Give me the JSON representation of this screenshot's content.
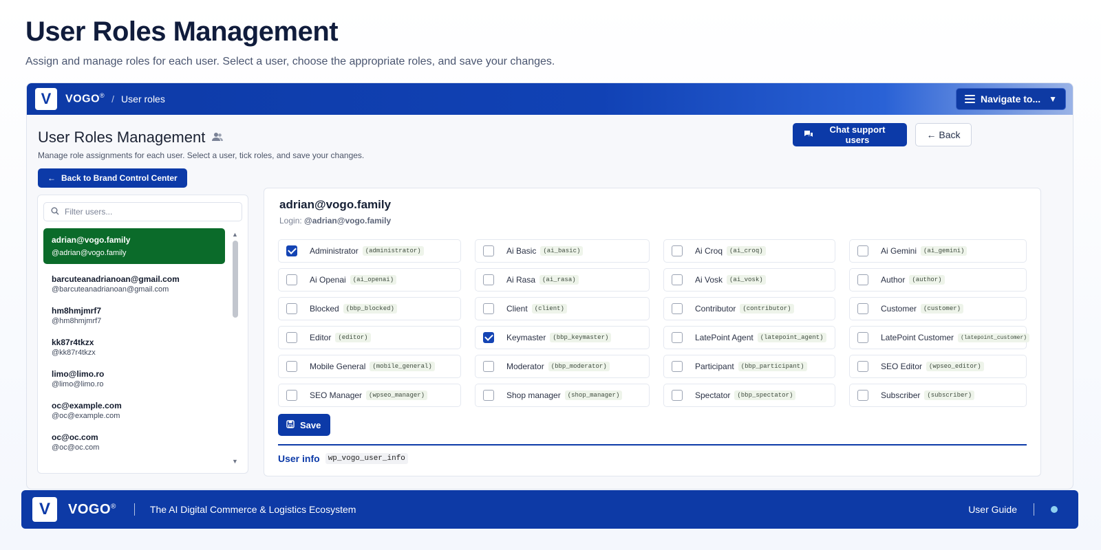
{
  "page": {
    "title": "User Roles Management",
    "subtitle": "Assign and manage roles for each user. Select a user, choose the appropriate roles, and save your changes."
  },
  "topbar": {
    "logo_letter": "V",
    "brand": "VOGO",
    "brand_mark": "®",
    "crumb_sep": "/",
    "crumb": "User roles",
    "nav_label": "Navigate to...",
    "nav_icon": "menu-icon",
    "nav_chevron": "⌄"
  },
  "card": {
    "title": "User Roles Management",
    "title_icon": "users-icon",
    "subtitle": "Manage role assignments for each user. Select a user, tick roles, and save your changes.",
    "back_brand_label": "Back to Brand Control Center",
    "chat_label": "Chat support users",
    "back_label": "← Back"
  },
  "users": {
    "filter_placeholder": "Filter users...",
    "items": [
      {
        "email": "adrian@vogo.family",
        "login": "@adrian@vogo.family",
        "selected": true
      },
      {
        "email": "barcuteanadrianoan@gmail.com",
        "login": "@barcuteanadrianoan@gmail.com"
      },
      {
        "email": "hm8hmjmrf7",
        "login": "@hm8hmjmrf7"
      },
      {
        "email": "kk87r4tkzx",
        "login": "@kk87r4tkzx"
      },
      {
        "email": "limo@limo.ro",
        "login": "@limo@limo.ro"
      },
      {
        "email": "oc@example.com",
        "login": "@oc@example.com"
      },
      {
        "email": "oc@oc.com",
        "login": "@oc@oc.com"
      }
    ]
  },
  "selected_user": {
    "email": "adrian@vogo.family",
    "login_label": "Login:",
    "login": "@adrian@vogo.family"
  },
  "roles": [
    {
      "label": "Administrator",
      "slug": "(administrator)",
      "checked": true
    },
    {
      "label": "Ai Basic",
      "slug": "(ai_basic)",
      "checked": false
    },
    {
      "label": "Ai Croq",
      "slug": "(ai_croq)",
      "checked": false
    },
    {
      "label": "Ai Gemini",
      "slug": "(ai_gemini)",
      "checked": false
    },
    {
      "label": "Ai Openai",
      "slug": "(ai_openai)",
      "checked": false
    },
    {
      "label": "Ai Rasa",
      "slug": "(ai_rasa)",
      "checked": false
    },
    {
      "label": "Ai Vosk",
      "slug": "(ai_vosk)",
      "checked": false
    },
    {
      "label": "Author",
      "slug": "(author)",
      "checked": false
    },
    {
      "label": "Blocked",
      "slug": "(bbp_blocked)",
      "checked": false
    },
    {
      "label": "Client",
      "slug": "(client)",
      "checked": false
    },
    {
      "label": "Contributor",
      "slug": "(contributor)",
      "checked": false
    },
    {
      "label": "Customer",
      "slug": "(customer)",
      "checked": false
    },
    {
      "label": "Editor",
      "slug": "(editor)",
      "checked": false
    },
    {
      "label": "Keymaster",
      "slug": "(bbp_keymaster)",
      "checked": true
    },
    {
      "label": "LatePoint Agent",
      "slug": "(latepoint_agent)",
      "checked": false
    },
    {
      "label": "LatePoint Customer",
      "slug": "(latepoint_customer)",
      "checked": false
    },
    {
      "label": "Mobile General",
      "slug": "(mobile_general)",
      "checked": false
    },
    {
      "label": "Moderator",
      "slug": "(bbp_moderator)",
      "checked": false
    },
    {
      "label": "Participant",
      "slug": "(bbp_participant)",
      "checked": false
    },
    {
      "label": "SEO Editor",
      "slug": "(wpseo_editor)",
      "checked": false
    },
    {
      "label": "SEO Manager",
      "slug": "(wpseo_manager)",
      "checked": false
    },
    {
      "label": "Shop manager",
      "slug": "(shop_manager)",
      "checked": false
    },
    {
      "label": "Spectator",
      "slug": "(bbp_spectator)",
      "checked": false
    },
    {
      "label": "Subscriber",
      "slug": "(subscriber)",
      "checked": false
    }
  ],
  "actions": {
    "save_label": "Save",
    "save_icon": "floppy-icon"
  },
  "user_info": {
    "label": "User info",
    "meta_key": "wp_vogo_user_info"
  },
  "footer": {
    "logo_letter": "V",
    "brand": "VOGO",
    "brand_mark": "®",
    "tagline": "The AI Digital Commerce & Logistics Ecosystem",
    "guide_label": "User Guide"
  },
  "colors": {
    "primary": "#0c3aa8",
    "selected_user_bg": "#0b6b2a",
    "checkbox_checked": "#1444b4",
    "slug_bg": "#eef4ea"
  }
}
